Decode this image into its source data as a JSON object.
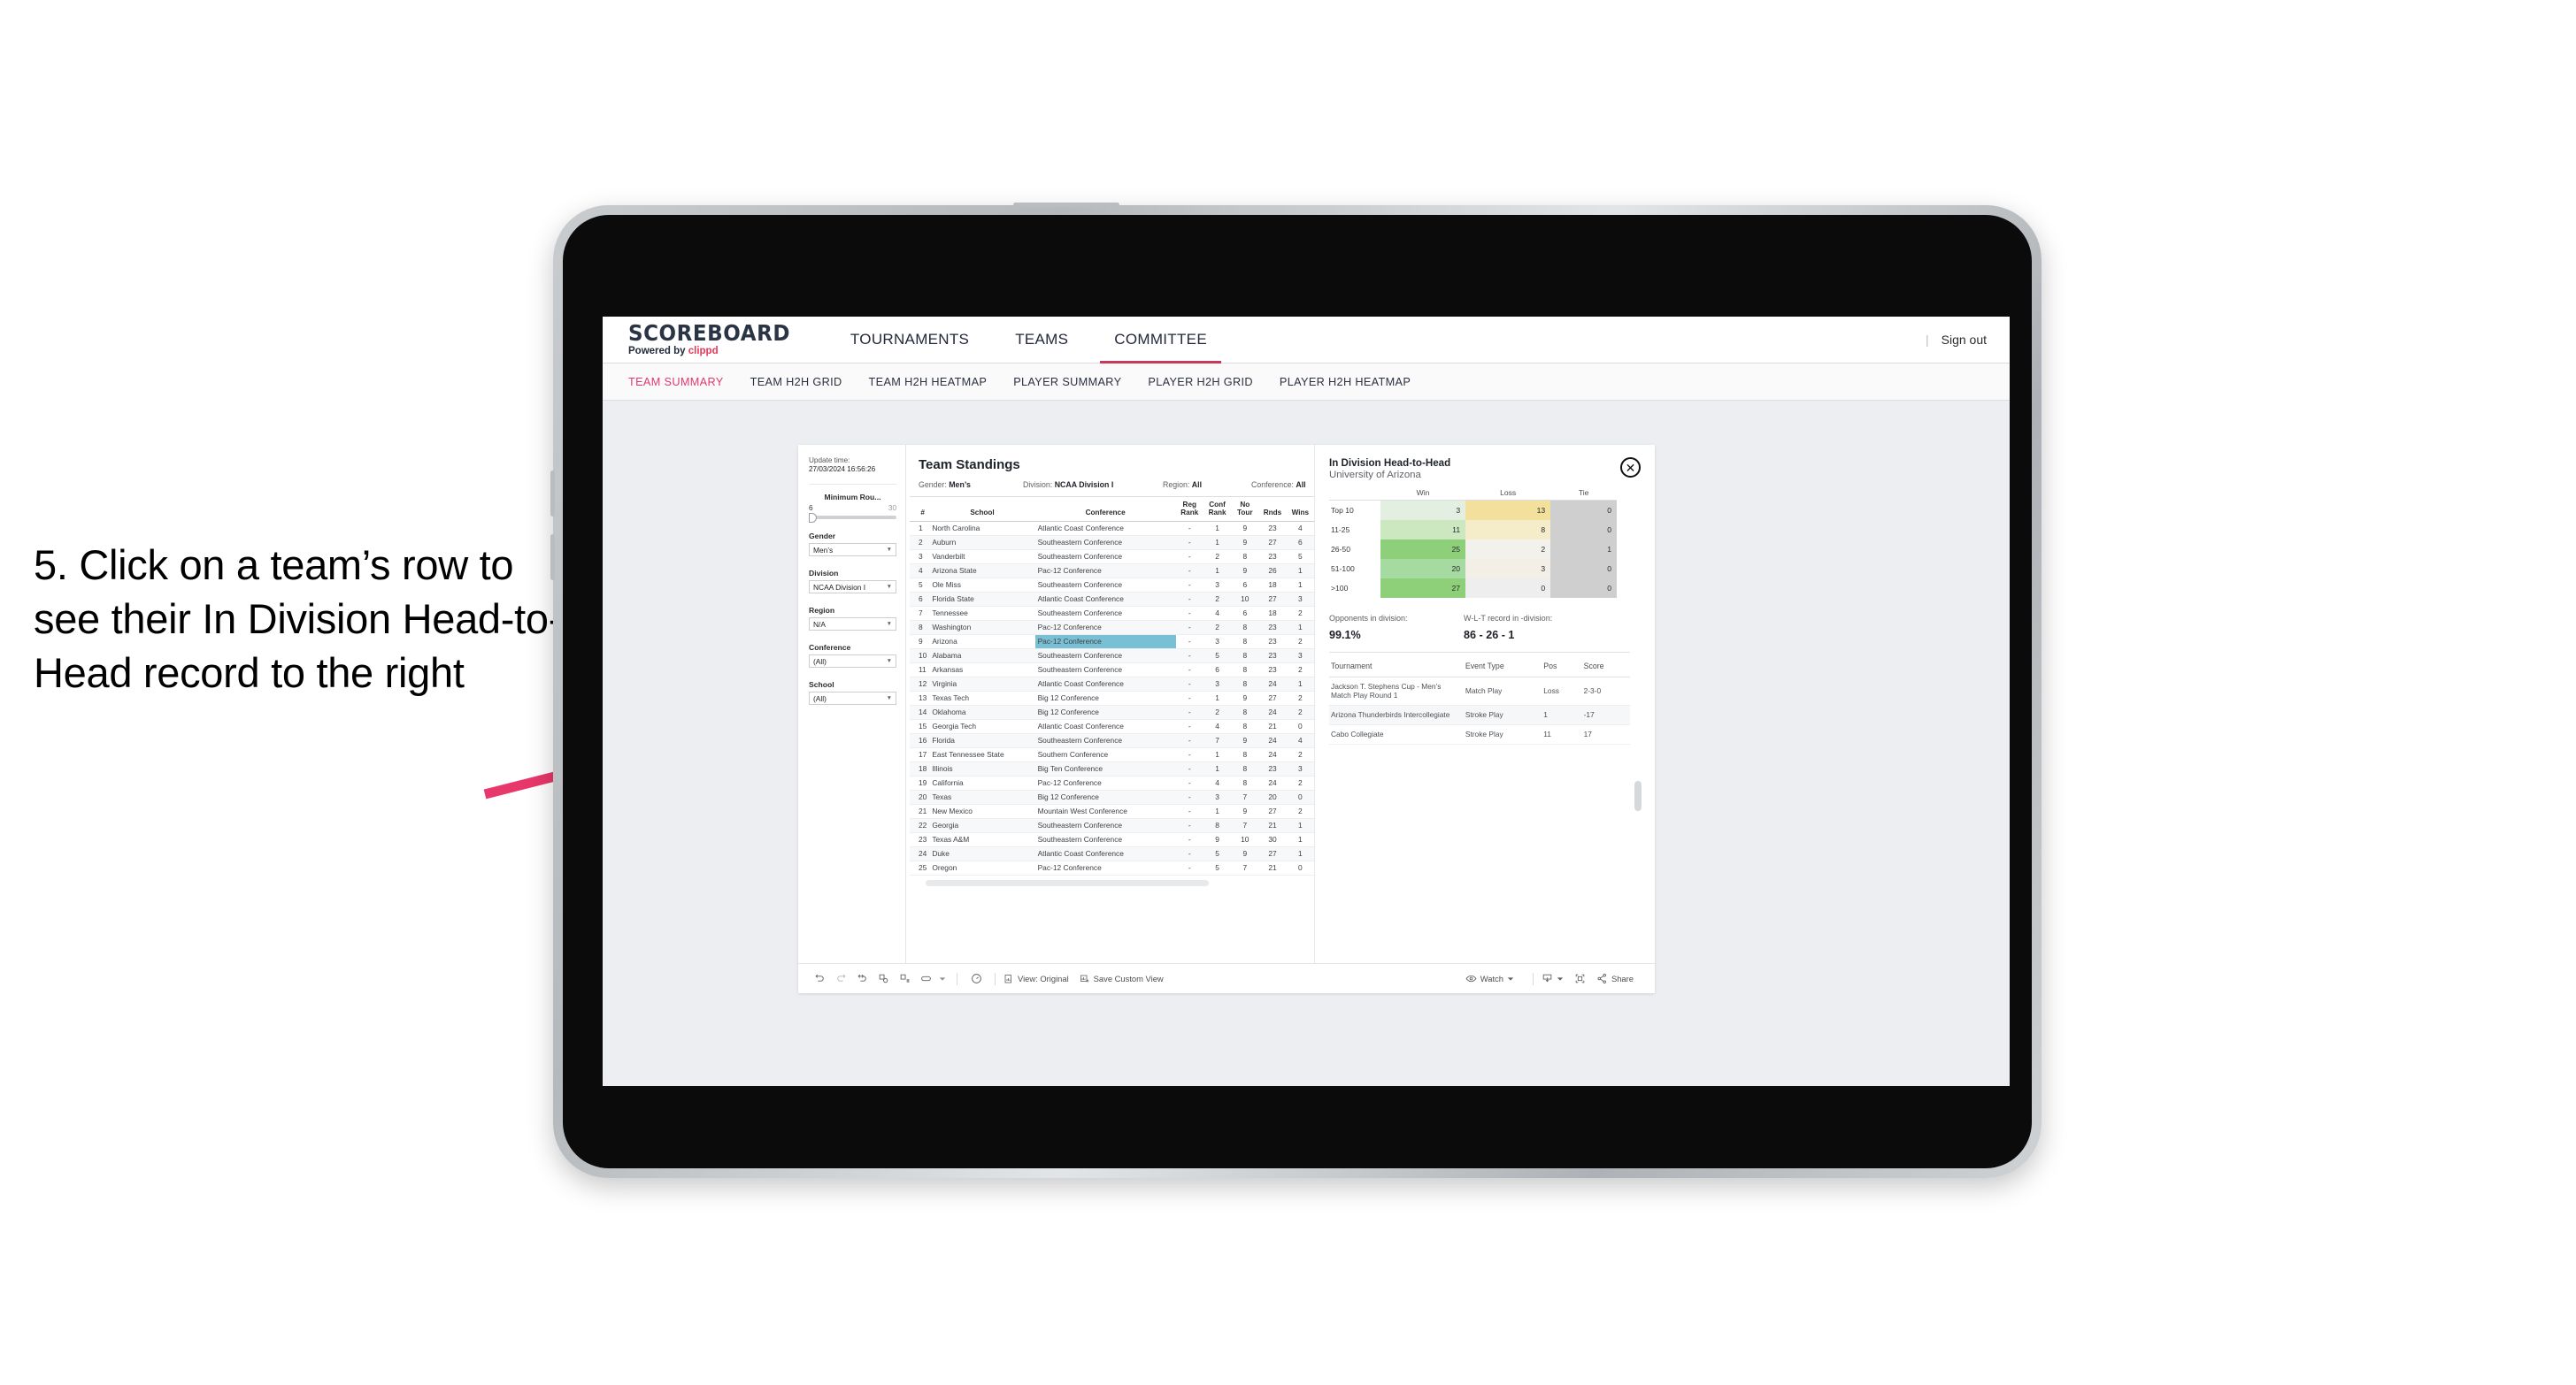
{
  "callout": {
    "text": "5. Click on a team’s row to see their In Division Head-to-Head record to the right",
    "arrow_color": "#e8376b"
  },
  "app": {
    "brand": {
      "title": "SCOREBOARD",
      "powered_prefix": "Powered by ",
      "powered_name": "clippd",
      "accent": "#e8375a"
    },
    "top_nav": [
      {
        "label": "TOURNAMENTS",
        "active": false
      },
      {
        "label": "TEAMS",
        "active": false
      },
      {
        "label": "COMMITTEE",
        "active": true
      }
    ],
    "sign_out": "Sign out",
    "sub_tabs": [
      {
        "label": "TEAM SUMMARY",
        "active": true
      },
      {
        "label": "TEAM H2H GRID",
        "active": false
      },
      {
        "label": "TEAM H2H HEATMAP",
        "active": false
      },
      {
        "label": "PLAYER SUMMARY",
        "active": false
      },
      {
        "label": "PLAYER H2H GRID",
        "active": false
      },
      {
        "label": "PLAYER H2H HEATMAP",
        "active": false
      }
    ]
  },
  "filters": {
    "update_label": "Update time:",
    "update_time": "27/03/2024 16:56:26",
    "min_rounds": {
      "label": "Minimum Rou...",
      "low": "6",
      "high": "30"
    },
    "gender": {
      "label": "Gender",
      "value": "Men’s"
    },
    "division": {
      "label": "Division",
      "value": "NCAA Division I"
    },
    "region": {
      "label": "Region",
      "value": "N/A"
    },
    "conference": {
      "label": "Conference",
      "value": "(All)"
    },
    "school": {
      "label": "School",
      "value": "(All)"
    }
  },
  "standings": {
    "title": "Team Standings",
    "crumbs": [
      {
        "label": "Gender: ",
        "value": "Men’s"
      },
      {
        "label": "Division: ",
        "value": "NCAA Division I"
      },
      {
        "label": "Region: ",
        "value": "All"
      },
      {
        "label": "Conference: ",
        "value": "All"
      }
    ],
    "columns": [
      "#",
      "School",
      "Conference",
      "Reg Rank",
      "Conf Rank",
      "No Tour",
      "Rnds",
      "Wins"
    ],
    "selected_row_index": 9,
    "rows": [
      {
        "n": "1",
        "school": "North Carolina",
        "conf": "Atlantic Coast Conference",
        "reg": "-",
        "crank": "1",
        "notour": "9",
        "rnds": "23",
        "wins": "4"
      },
      {
        "n": "2",
        "school": "Auburn",
        "conf": "Southeastern Conference",
        "reg": "-",
        "crank": "1",
        "notour": "9",
        "rnds": "27",
        "wins": "6"
      },
      {
        "n": "3",
        "school": "Vanderbilt",
        "conf": "Southeastern Conference",
        "reg": "-",
        "crank": "2",
        "notour": "8",
        "rnds": "23",
        "wins": "5"
      },
      {
        "n": "4",
        "school": "Arizona State",
        "conf": "Pac-12 Conference",
        "reg": "-",
        "crank": "1",
        "notour": "9",
        "rnds": "26",
        "wins": "1"
      },
      {
        "n": "5",
        "school": "Ole Miss",
        "conf": "Southeastern Conference",
        "reg": "-",
        "crank": "3",
        "notour": "6",
        "rnds": "18",
        "wins": "1"
      },
      {
        "n": "6",
        "school": "Florida State",
        "conf": "Atlantic Coast Conference",
        "reg": "-",
        "crank": "2",
        "notour": "10",
        "rnds": "27",
        "wins": "3"
      },
      {
        "n": "7",
        "school": "Tennessee",
        "conf": "Southeastern Conference",
        "reg": "-",
        "crank": "4",
        "notour": "6",
        "rnds": "18",
        "wins": "2"
      },
      {
        "n": "8",
        "school": "Washington",
        "conf": "Pac-12 Conference",
        "reg": "-",
        "crank": "2",
        "notour": "8",
        "rnds": "23",
        "wins": "1"
      },
      {
        "n": "9",
        "school": "Arizona",
        "conf": "Pac-12 Conference",
        "reg": "-",
        "crank": "3",
        "notour": "8",
        "rnds": "23",
        "wins": "2"
      },
      {
        "n": "10",
        "school": "Alabama",
        "conf": "Southeastern Conference",
        "reg": "-",
        "crank": "5",
        "notour": "8",
        "rnds": "23",
        "wins": "3"
      },
      {
        "n": "11",
        "school": "Arkansas",
        "conf": "Southeastern Conference",
        "reg": "-",
        "crank": "6",
        "notour": "8",
        "rnds": "23",
        "wins": "2"
      },
      {
        "n": "12",
        "school": "Virginia",
        "conf": "Atlantic Coast Conference",
        "reg": "-",
        "crank": "3",
        "notour": "8",
        "rnds": "24",
        "wins": "1"
      },
      {
        "n": "13",
        "school": "Texas Tech",
        "conf": "Big 12 Conference",
        "reg": "-",
        "crank": "1",
        "notour": "9",
        "rnds": "27",
        "wins": "2"
      },
      {
        "n": "14",
        "school": "Oklahoma",
        "conf": "Big 12 Conference",
        "reg": "-",
        "crank": "2",
        "notour": "8",
        "rnds": "24",
        "wins": "2"
      },
      {
        "n": "15",
        "school": "Georgia Tech",
        "conf": "Atlantic Coast Conference",
        "reg": "-",
        "crank": "4",
        "notour": "8",
        "rnds": "21",
        "wins": "0"
      },
      {
        "n": "16",
        "school": "Florida",
        "conf": "Southeastern Conference",
        "reg": "-",
        "crank": "7",
        "notour": "9",
        "rnds": "24",
        "wins": "4"
      },
      {
        "n": "17",
        "school": "East Tennessee State",
        "conf": "Southern Conference",
        "reg": "-",
        "crank": "1",
        "notour": "8",
        "rnds": "24",
        "wins": "2"
      },
      {
        "n": "18",
        "school": "Illinois",
        "conf": "Big Ten Conference",
        "reg": "-",
        "crank": "1",
        "notour": "8",
        "rnds": "23",
        "wins": "3"
      },
      {
        "n": "19",
        "school": "California",
        "conf": "Pac-12 Conference",
        "reg": "-",
        "crank": "4",
        "notour": "8",
        "rnds": "24",
        "wins": "2"
      },
      {
        "n": "20",
        "school": "Texas",
        "conf": "Big 12 Conference",
        "reg": "-",
        "crank": "3",
        "notour": "7",
        "rnds": "20",
        "wins": "0"
      },
      {
        "n": "21",
        "school": "New Mexico",
        "conf": "Mountain West Conference",
        "reg": "-",
        "crank": "1",
        "notour": "9",
        "rnds": "27",
        "wins": "2"
      },
      {
        "n": "22",
        "school": "Georgia",
        "conf": "Southeastern Conference",
        "reg": "-",
        "crank": "8",
        "notour": "7",
        "rnds": "21",
        "wins": "1"
      },
      {
        "n": "23",
        "school": "Texas A&M",
        "conf": "Southeastern Conference",
        "reg": "-",
        "crank": "9",
        "notour": "10",
        "rnds": "30",
        "wins": "1"
      },
      {
        "n": "24",
        "school": "Duke",
        "conf": "Atlantic Coast Conference",
        "reg": "-",
        "crank": "5",
        "notour": "9",
        "rnds": "27",
        "wins": "1"
      },
      {
        "n": "25",
        "school": "Oregon",
        "conf": "Pac-12 Conference",
        "reg": "-",
        "crank": "5",
        "notour": "7",
        "rnds": "21",
        "wins": "0"
      }
    ]
  },
  "h2h": {
    "title": "In Division Head-to-Head",
    "subtitle": "University of Arizona",
    "close_icon": "close-circle-icon",
    "columns": [
      "Win",
      "Loss",
      "Tie"
    ],
    "rows": [
      {
        "label": "Top 10",
        "win": "3",
        "loss": "13",
        "tie": "0",
        "win_color": "#e2efe1",
        "loss_color": "#f2e09c",
        "tie_color": "#cfcfcf"
      },
      {
        "label": "11-25",
        "win": "11",
        "loss": "8",
        "tie": "0",
        "win_color": "#cbe8c0",
        "loss_color": "#f5ecc9",
        "tie_color": "#cfcfcf"
      },
      {
        "label": "26-50",
        "win": "25",
        "loss": "2",
        "tie": "1",
        "win_color": "#8ed07a",
        "loss_color": "#f2f1ec",
        "tie_color": "#cfcfcf"
      },
      {
        "label": "51-100",
        "win": "20",
        "loss": "3",
        "tie": "0",
        "win_color": "#a5daa0",
        "loss_color": "#f3efe6",
        "tie_color": "#cfcfcf"
      },
      {
        "label": ">100",
        "win": "27",
        "loss": "0",
        "tie": "0",
        "win_color": "#8ed07a",
        "loss_color": "#eeeeee",
        "tie_color": "#cfcfcf"
      }
    ],
    "opponents_label": "Opponents in division:",
    "opponents_value": "99.1%",
    "record_label": "W-L-T record in -division:",
    "record_value": "86 - 26 - 1",
    "tournament_columns": [
      "Tournament",
      "Event Type",
      "Pos",
      "Score"
    ],
    "tournaments": [
      {
        "name": "Jackson T. Stephens Cup - Men’s Match Play Round 1",
        "type": "Match Play",
        "pos": "Loss",
        "score": "2-3-0"
      },
      {
        "name": "Arizona Thunderbirds Intercollegiate",
        "type": "Stroke Play",
        "pos": "1",
        "score": "-17"
      },
      {
        "name": "Cabo Collegiate",
        "type": "Stroke Play",
        "pos": "11",
        "score": "17"
      }
    ]
  },
  "toolbar": {
    "undo": "undo-icon",
    "redo": "redo-icon",
    "revert": "revert-icon",
    "refresh": "refresh-data-icon",
    "pause": "pause-auto-update-icon",
    "device_layout": "device-layout-icon",
    "dropdown": "chevron-down-icon",
    "clock": "dashboard-speed-icon",
    "view_label": "View: Original",
    "save_label": "Save Custom View",
    "watch_label": "Watch",
    "download_icon": "download-icon",
    "fullscreen_icon": "fullscreen-icon",
    "share_label": "Share"
  }
}
